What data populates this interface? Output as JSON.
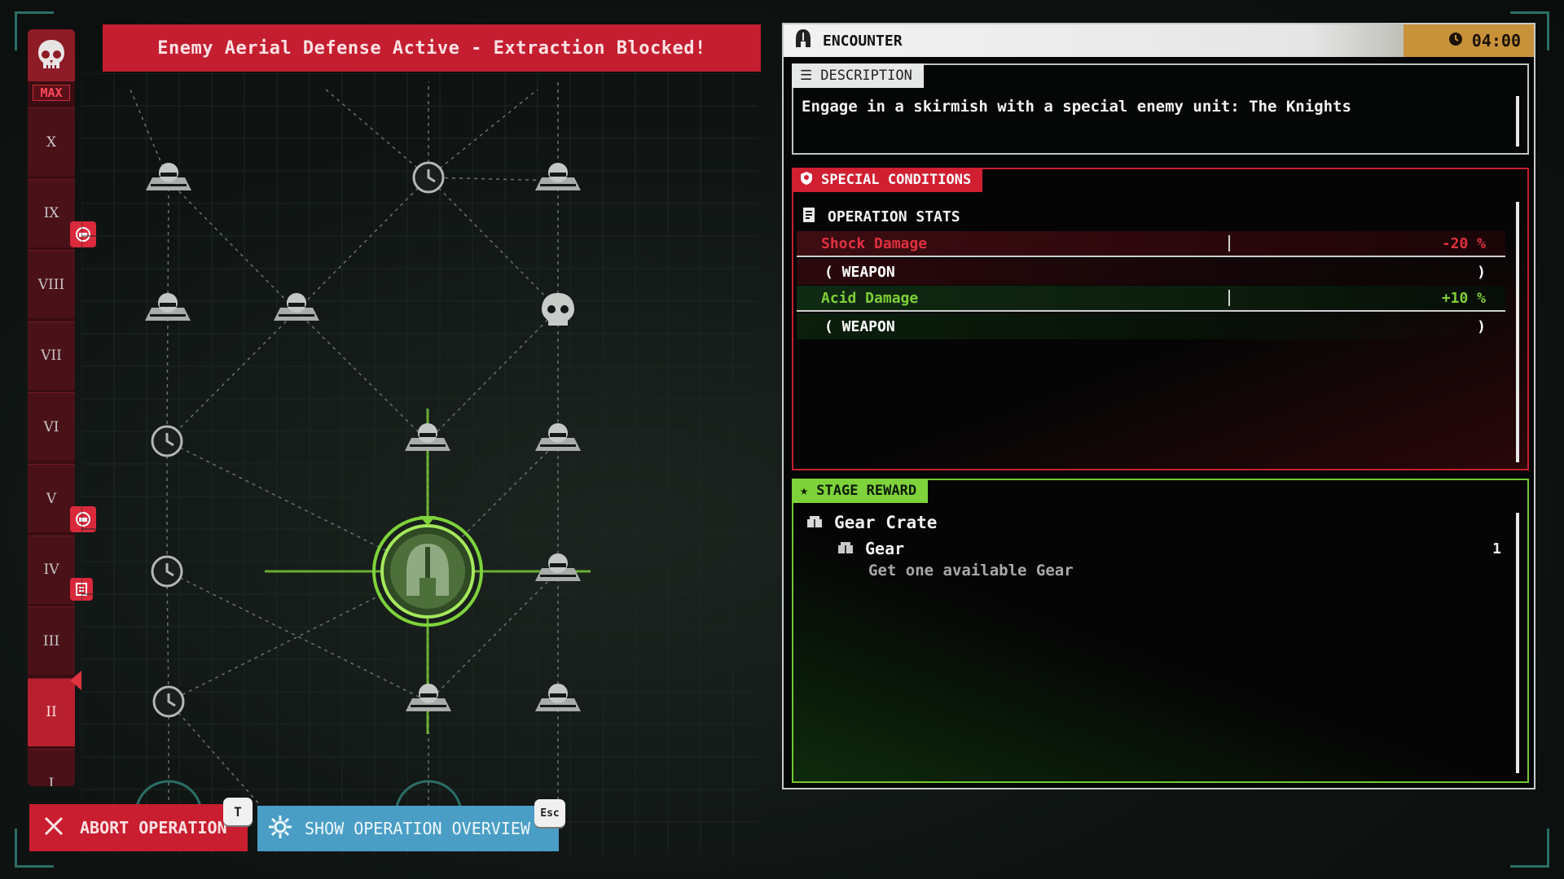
{
  "banner": {
    "text": "Enemy Aerial Defense Active - Extraction Blocked!"
  },
  "stage_bar": {
    "max_label": "MAX",
    "stages": [
      "X",
      "IX",
      "VIII",
      "VII",
      "VI",
      "V",
      "IV",
      "III",
      "II",
      "I"
    ],
    "current_stage": "II"
  },
  "map": {
    "node_icons": [
      "enemy-squad-icon",
      "timer-icon",
      "skull-icon",
      "knight-helmet-icon"
    ]
  },
  "encounter": {
    "title": "ENCOUNTER",
    "timer": "04:00",
    "description": {
      "tab_label": "DESCRIPTION",
      "text": "Engage in a skirmish with a special enemy unit: The Knights"
    },
    "special_conditions": {
      "tab_label": "SPECIAL CONDITIONS",
      "section_title": "OPERATION STATS",
      "stats": [
        {
          "name": "Shock Damage",
          "value": "-20 %",
          "sub_left": "( WEAPON",
          "sub_right": ")",
          "kind": "negative"
        },
        {
          "name": "Acid Damage",
          "value": "+10 %",
          "sub_left": "( WEAPON",
          "sub_right": ")",
          "kind": "positive"
        }
      ]
    },
    "stage_reward": {
      "tab_label": "STAGE REWARD",
      "crate_name": "Gear Crate",
      "item_name": "Gear",
      "item_quantity": "1",
      "item_description": "Get one available Gear"
    }
  },
  "buttons": {
    "abort_label": "ABORT OPERATION",
    "abort_key": "T",
    "overview_label": "SHOW OPERATION OVERVIEW",
    "overview_key": "Esc"
  },
  "colors": {
    "danger": "#c41e30",
    "accent_green": "#7ed23a",
    "timer_amber": "#c8923a",
    "overview_blue": "#4a9ec6"
  }
}
